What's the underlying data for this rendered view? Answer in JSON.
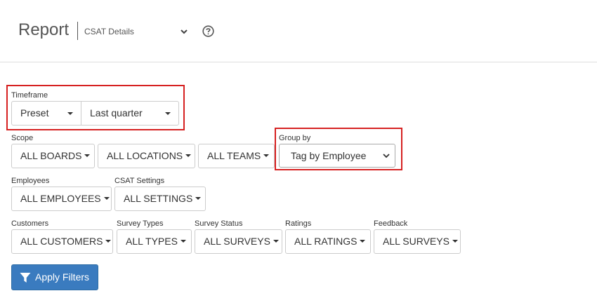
{
  "header": {
    "title": "Report",
    "report_select_value": "CSAT Details",
    "help_icon": "question-circle-icon"
  },
  "timeframe": {
    "label": "Timeframe",
    "preset": "Preset",
    "range": "Last quarter"
  },
  "scope": {
    "label": "Scope",
    "boards": "ALL BOARDS",
    "locations": "ALL LOCATIONS",
    "teams": "ALL TEAMS"
  },
  "group_by": {
    "label": "Group by",
    "value": "Tag by Employee"
  },
  "employees": {
    "label": "Employees",
    "value": "ALL EMPLOYEES"
  },
  "csat_settings": {
    "label": "CSAT Settings",
    "value": "ALL SETTINGS"
  },
  "customers": {
    "label": "Customers",
    "value": "ALL CUSTOMERS"
  },
  "survey_types": {
    "label": "Survey Types",
    "value": "ALL TYPES"
  },
  "survey_status": {
    "label": "Survey Status",
    "value": "ALL SURVEYS"
  },
  "ratings": {
    "label": "Ratings",
    "value": "ALL RATINGS"
  },
  "feedback": {
    "label": "Feedback",
    "value": "ALL SURVEYS"
  },
  "apply_button": {
    "label": "Apply Filters",
    "icon": "filter-icon"
  },
  "colors": {
    "primary": "#3a7bbf",
    "highlight": "#d62121"
  }
}
